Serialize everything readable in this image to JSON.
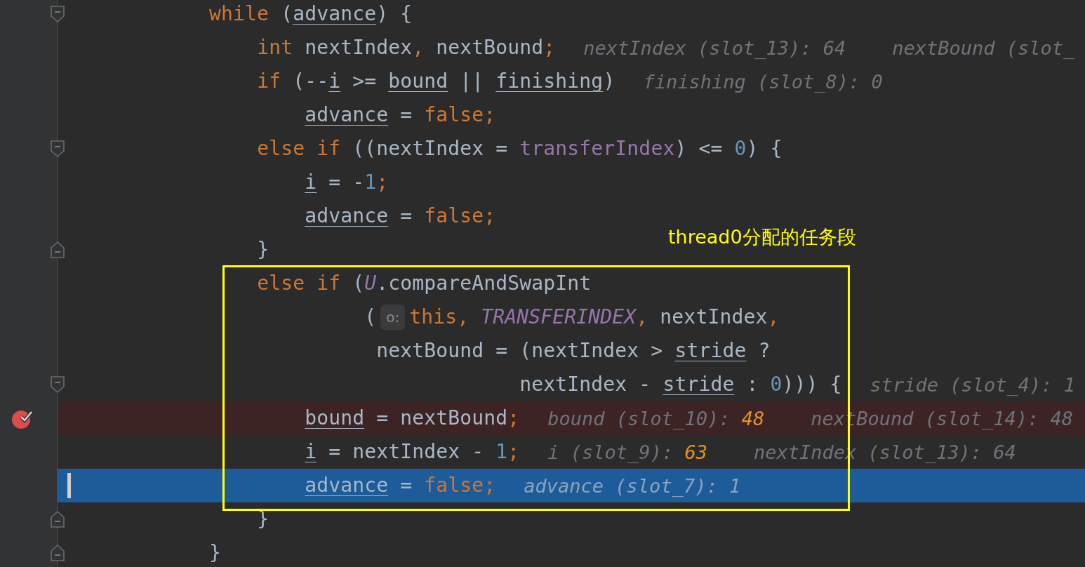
{
  "editor": {
    "lines": [
      {
        "fold_start": true,
        "fold_end": false,
        "breakpoint": false,
        "current": false,
        "tokens": [
          {
            "kind": "kw",
            "text": "            while "
          },
          {
            "kind": "plain",
            "text": "("
          },
          {
            "kind": "var",
            "text": "advance"
          },
          {
            "kind": "plain",
            "text": ") {"
          }
        ]
      },
      {
        "fold_start": false,
        "fold_end": false,
        "breakpoint": false,
        "current": false,
        "tokens": [
          {
            "kind": "kw",
            "text": "                int "
          },
          {
            "kind": "plain",
            "text": "nextIndex"
          },
          {
            "kind": "punct",
            "text": ", "
          },
          {
            "kind": "plain",
            "text": "nextBound"
          },
          {
            "kind": "punct",
            "text": ";"
          }
        ],
        "inlays": [
          {
            "label": "nextIndex (slot_13):",
            "value": "64",
            "changed": false
          },
          {
            "label": "nextBound (slot_"
          }
        ]
      },
      {
        "fold_start": false,
        "fold_end": false,
        "breakpoint": false,
        "current": false,
        "tokens": [
          {
            "kind": "kw",
            "text": "                if "
          },
          {
            "kind": "plain",
            "text": "(--"
          },
          {
            "kind": "var",
            "text": "i"
          },
          {
            "kind": "plain",
            "text": " >= "
          },
          {
            "kind": "var",
            "text": "bound"
          },
          {
            "kind": "plain",
            "text": " || "
          },
          {
            "kind": "var",
            "text": "finishing"
          },
          {
            "kind": "plain",
            "text": ")"
          }
        ],
        "inlays": [
          {
            "label": "finishing (slot_8):",
            "value": "0",
            "changed": false
          }
        ]
      },
      {
        "fold_start": false,
        "fold_end": false,
        "breakpoint": false,
        "current": false,
        "tokens": [
          {
            "kind": "var",
            "text": "                    advance"
          },
          {
            "kind": "plain",
            "text": " = "
          },
          {
            "kind": "kw",
            "text": "false"
          },
          {
            "kind": "punct",
            "text": ";"
          }
        ]
      },
      {
        "fold_start": true,
        "fold_end": false,
        "breakpoint": false,
        "current": false,
        "tokens": [
          {
            "kind": "kw",
            "text": "                else if "
          },
          {
            "kind": "plain",
            "text": "((nextIndex = "
          },
          {
            "kind": "field",
            "text": "transferIndex"
          },
          {
            "kind": "plain",
            "text": ") <= "
          },
          {
            "kind": "num",
            "text": "0"
          },
          {
            "kind": "plain",
            "text": ") {"
          }
        ]
      },
      {
        "fold_start": false,
        "fold_end": false,
        "breakpoint": false,
        "current": false,
        "tokens": [
          {
            "kind": "var",
            "text": "                    i"
          },
          {
            "kind": "plain",
            "text": " = -"
          },
          {
            "kind": "num",
            "text": "1"
          },
          {
            "kind": "punct",
            "text": ";"
          }
        ]
      },
      {
        "fold_start": false,
        "fold_end": false,
        "breakpoint": false,
        "current": false,
        "tokens": [
          {
            "kind": "var",
            "text": "                    advance"
          },
          {
            "kind": "plain",
            "text": " = "
          },
          {
            "kind": "kw",
            "text": "false"
          },
          {
            "kind": "punct",
            "text": ";"
          }
        ]
      },
      {
        "fold_start": false,
        "fold_end": true,
        "breakpoint": false,
        "current": false,
        "tokens": [
          {
            "kind": "plain",
            "text": "                }"
          }
        ]
      },
      {
        "fold_start": false,
        "fold_end": false,
        "breakpoint": false,
        "current": false,
        "tokens": [
          {
            "kind": "kw",
            "text": "                else if "
          },
          {
            "kind": "plain",
            "text": "("
          },
          {
            "kind": "static",
            "text": "U"
          },
          {
            "kind": "plain",
            "text": ".compareAndSwapInt"
          }
        ]
      },
      {
        "fold_start": false,
        "fold_end": false,
        "breakpoint": false,
        "current": false,
        "tokens": [
          {
            "kind": "plain",
            "text": "                         ("
          },
          {
            "kind": "hint",
            "text": "o:"
          },
          {
            "kind": "kw",
            "text": "this"
          },
          {
            "kind": "punct",
            "text": ", "
          },
          {
            "kind": "static",
            "text": "TRANSFERINDEX"
          },
          {
            "kind": "punct",
            "text": ", "
          },
          {
            "kind": "plain",
            "text": "nextIndex"
          },
          {
            "kind": "punct",
            "text": ","
          }
        ]
      },
      {
        "fold_start": false,
        "fold_end": false,
        "breakpoint": false,
        "current": false,
        "tokens": [
          {
            "kind": "plain",
            "text": "                          nextBound = (nextIndex > "
          },
          {
            "kind": "var",
            "text": "stride"
          },
          {
            "kind": "plain",
            "text": " ?"
          }
        ]
      },
      {
        "fold_start": true,
        "fold_end": false,
        "breakpoint": false,
        "current": false,
        "tokens": [
          {
            "kind": "plain",
            "text": "                                      nextIndex - "
          },
          {
            "kind": "var",
            "text": "stride"
          },
          {
            "kind": "plain",
            "text": " : "
          },
          {
            "kind": "num",
            "text": "0"
          },
          {
            "kind": "plain",
            "text": "))) {"
          }
        ],
        "inlays": [
          {
            "label": "stride (slot_4): 1"
          }
        ]
      },
      {
        "fold_start": false,
        "fold_end": false,
        "breakpoint": true,
        "current": false,
        "tokens": [
          {
            "kind": "var",
            "text": "                    bound"
          },
          {
            "kind": "plain",
            "text": " = nextBound"
          },
          {
            "kind": "punct",
            "text": ";"
          }
        ],
        "inlays": [
          {
            "label": "bound (slot_10):",
            "value": "48",
            "changed": true
          },
          {
            "label": "nextBound (slot_14): 48"
          }
        ]
      },
      {
        "fold_start": false,
        "fold_end": false,
        "breakpoint": false,
        "current": false,
        "tokens": [
          {
            "kind": "var",
            "text": "                    i"
          },
          {
            "kind": "plain",
            "text": " = nextIndex - "
          },
          {
            "kind": "num",
            "text": "1"
          },
          {
            "kind": "punct",
            "text": ";"
          }
        ],
        "inlays": [
          {
            "label": "i (slot_9):",
            "value": "63",
            "changed": true
          },
          {
            "label": "nextIndex (slot_13):",
            "value": "64",
            "changed": false
          }
        ]
      },
      {
        "fold_start": false,
        "fold_end": false,
        "breakpoint": false,
        "current": true,
        "tokens": [
          {
            "kind": "var",
            "text": "                    advance"
          },
          {
            "kind": "plain",
            "text": " = "
          },
          {
            "kind": "kw",
            "text": "false"
          },
          {
            "kind": "punct",
            "text": ";"
          }
        ],
        "inlays": [
          {
            "label": "advance (slot_7):",
            "value": "1",
            "changed": false
          }
        ]
      },
      {
        "fold_start": false,
        "fold_end": true,
        "breakpoint": false,
        "current": false,
        "tokens": [
          {
            "kind": "plain",
            "text": "                }"
          }
        ]
      },
      {
        "fold_start": false,
        "fold_end": true,
        "breakpoint": false,
        "current": false,
        "tokens": [
          {
            "kind": "plain",
            "text": "            }"
          }
        ]
      }
    ]
  },
  "annotation": {
    "label": "thread0分配的任务段"
  }
}
